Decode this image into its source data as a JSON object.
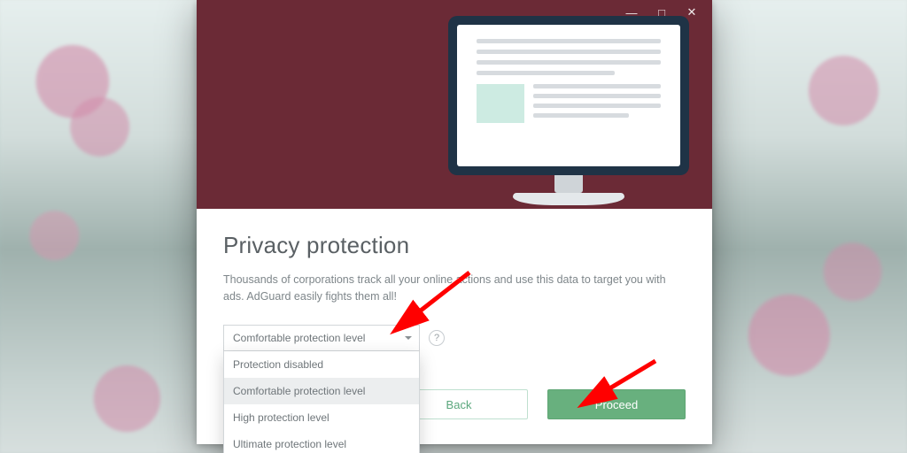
{
  "window_controls": {
    "minimize_glyph": "—",
    "maximize_glyph": "□",
    "close_glyph": "✕"
  },
  "header": {
    "title": "Privacy protection",
    "description": "Thousands of corporations track all your online actions and use this data to target you with ads. AdGuard easily fights them all!"
  },
  "select": {
    "current": "Comfortable protection level",
    "help_glyph": "?",
    "options": [
      "Protection disabled",
      "Comfortable protection level",
      "High protection level",
      "Ultimate protection level"
    ],
    "selected_index": 1
  },
  "buttons": {
    "back": "Back",
    "proceed": "Proceed"
  },
  "colors": {
    "hero_bg": "#6b2a36",
    "primary_btn": "#68b07e",
    "arrow": "#ff0000"
  }
}
